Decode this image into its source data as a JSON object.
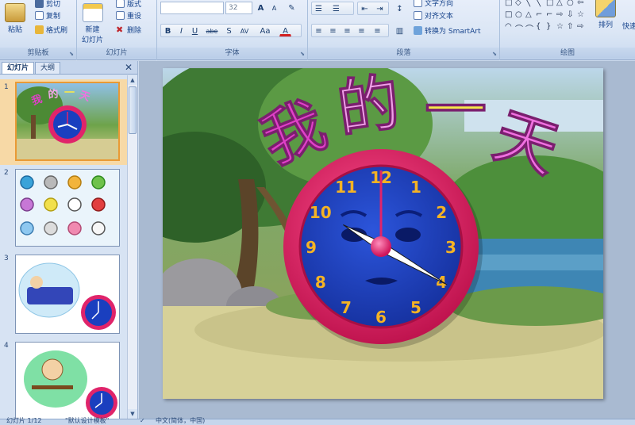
{
  "ribbon": {
    "clipboard": {
      "paste": "粘贴",
      "cut": "剪切",
      "copy": "复制",
      "format_painter": "格式刷",
      "label": "剪贴板"
    },
    "slides": {
      "new_slide": "新建",
      "new_slide_2": "幻灯片",
      "layout": "版式",
      "reset": "重设",
      "delete": "删除",
      "label": "幻灯片"
    },
    "font": {
      "font_name": "",
      "font_size": "32",
      "bold": "B",
      "italic": "I",
      "underline": "U",
      "strikethrough": "abe",
      "shadow": "S",
      "spacing": "AV",
      "change_case": "Aa",
      "font_color": "A",
      "grow": "A",
      "shrink": "A",
      "label": "字体"
    },
    "paragraph": {
      "text_direction": "文字方向",
      "align_text": "对齐文本",
      "smartart": "转换为 SmartArt",
      "label": "段落"
    },
    "drawing": {
      "arrange": "排列",
      "quick_styles": "快速",
      "label": "绘图"
    }
  },
  "left_panel": {
    "tabs": [
      "幻灯片",
      "大纲"
    ],
    "close": "✕",
    "slides": [
      {
        "number": "1",
        "title": "我的一天",
        "selected": true
      },
      {
        "number": "2",
        "selected": false
      },
      {
        "number": "3",
        "selected": false
      },
      {
        "number": "4",
        "selected": false
      }
    ]
  },
  "slide": {
    "title_chars": [
      "我",
      "的",
      "一",
      "天"
    ],
    "title_colors": [
      "#e040c8",
      "#f0a0e8",
      "#f7e84a",
      "#f070e0"
    ],
    "clock": {
      "numbers": [
        "12",
        "1",
        "2",
        "3",
        "4",
        "5",
        "6",
        "7",
        "8",
        "9",
        "10",
        "11"
      ],
      "hour": 4,
      "minute": 0,
      "second": 0,
      "rim_color": "#e0246a",
      "face_color": "#1a3fbf",
      "number_color": "#f5b324"
    }
  },
  "status_bar": {
    "slide_info": "幻灯片 1/12",
    "theme": "\"默认设计模板\"",
    "check": "✓",
    "language": "中文(简体，中国)"
  }
}
